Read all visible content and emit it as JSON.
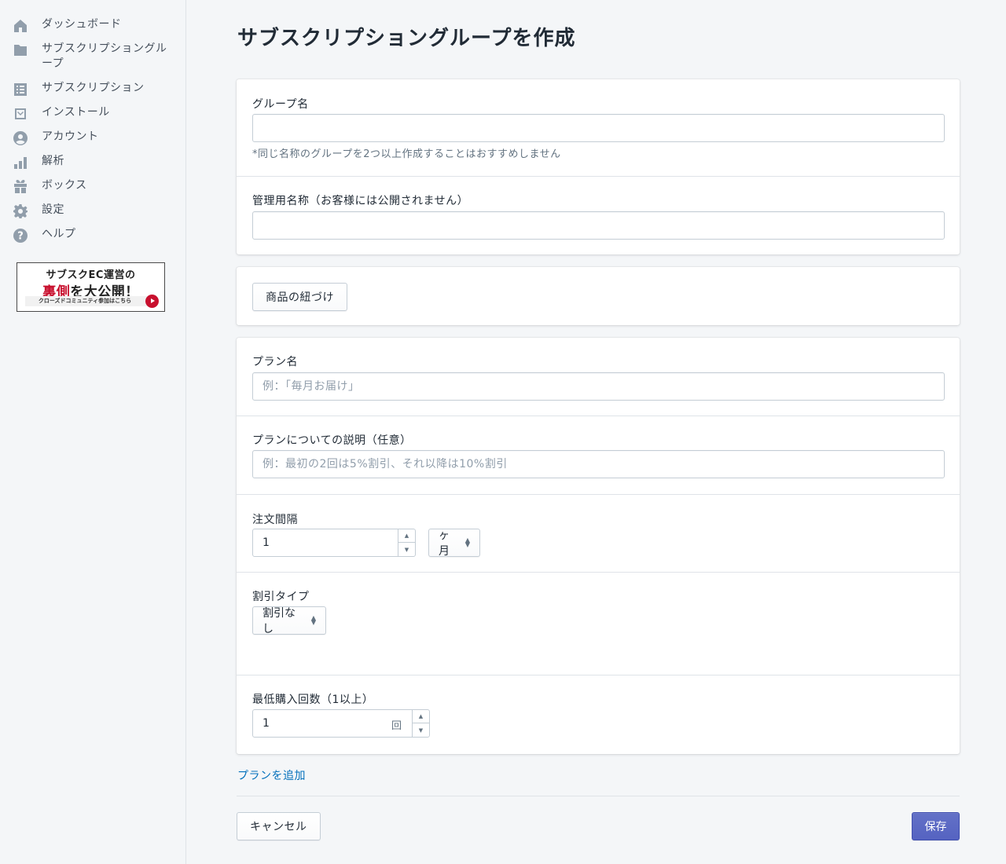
{
  "sidebar": {
    "items": [
      {
        "label": "ダッシュボード",
        "icon": "home-icon"
      },
      {
        "label": "サブスクリプショングループ",
        "icon": "folder-icon"
      },
      {
        "label": "サブスクリプション",
        "icon": "list-icon"
      },
      {
        "label": "インストール",
        "icon": "install-icon"
      },
      {
        "label": "アカウント",
        "icon": "account-icon"
      },
      {
        "label": "解析",
        "icon": "bar-chart-icon"
      },
      {
        "label": "ボックス",
        "icon": "gift-icon"
      },
      {
        "label": "設定",
        "icon": "gear-icon"
      },
      {
        "label": "ヘルプ",
        "icon": "help-icon"
      }
    ],
    "banner": {
      "line1": "サブスクEC運営の",
      "line2_red": "裏側",
      "line2_rest": "を大公開！",
      "line3": "クローズドコミュニティ参加はこちら"
    }
  },
  "page": {
    "title": "サブスクリプショングループを作成"
  },
  "group_card": {
    "group_name_label": "グループ名",
    "group_name_value": "",
    "group_name_help": "*同じ名称のグループを2つ以上作成することはおすすめしません",
    "admin_name_label": "管理用名称（お客様には公開されません）",
    "admin_name_value": ""
  },
  "product_card": {
    "link_button": "商品の紐づけ"
  },
  "plan_card": {
    "plan_name_label": "プラン名",
    "plan_name_placeholder": "例：「毎月お届け」",
    "plan_desc_label": "プランについての説明（任意）",
    "plan_desc_placeholder": "例：最初の2回は5%割引、それ以降は10%割引",
    "interval_label": "注文間隔",
    "interval_value": "1",
    "interval_unit": "ヶ月",
    "discount_label": "割引タイプ",
    "discount_value": "割引なし",
    "min_purchase_label": "最低購入回数（1以上）",
    "min_purchase_value": "1",
    "min_purchase_suffix": "回"
  },
  "footer": {
    "add_plan_link": "プランを追加",
    "cancel_button": "キャンセル",
    "save_button": "保存"
  },
  "colors": {
    "primary": "#5c6ac4",
    "link": "#006fbb",
    "banner_red": "#c8102e"
  }
}
